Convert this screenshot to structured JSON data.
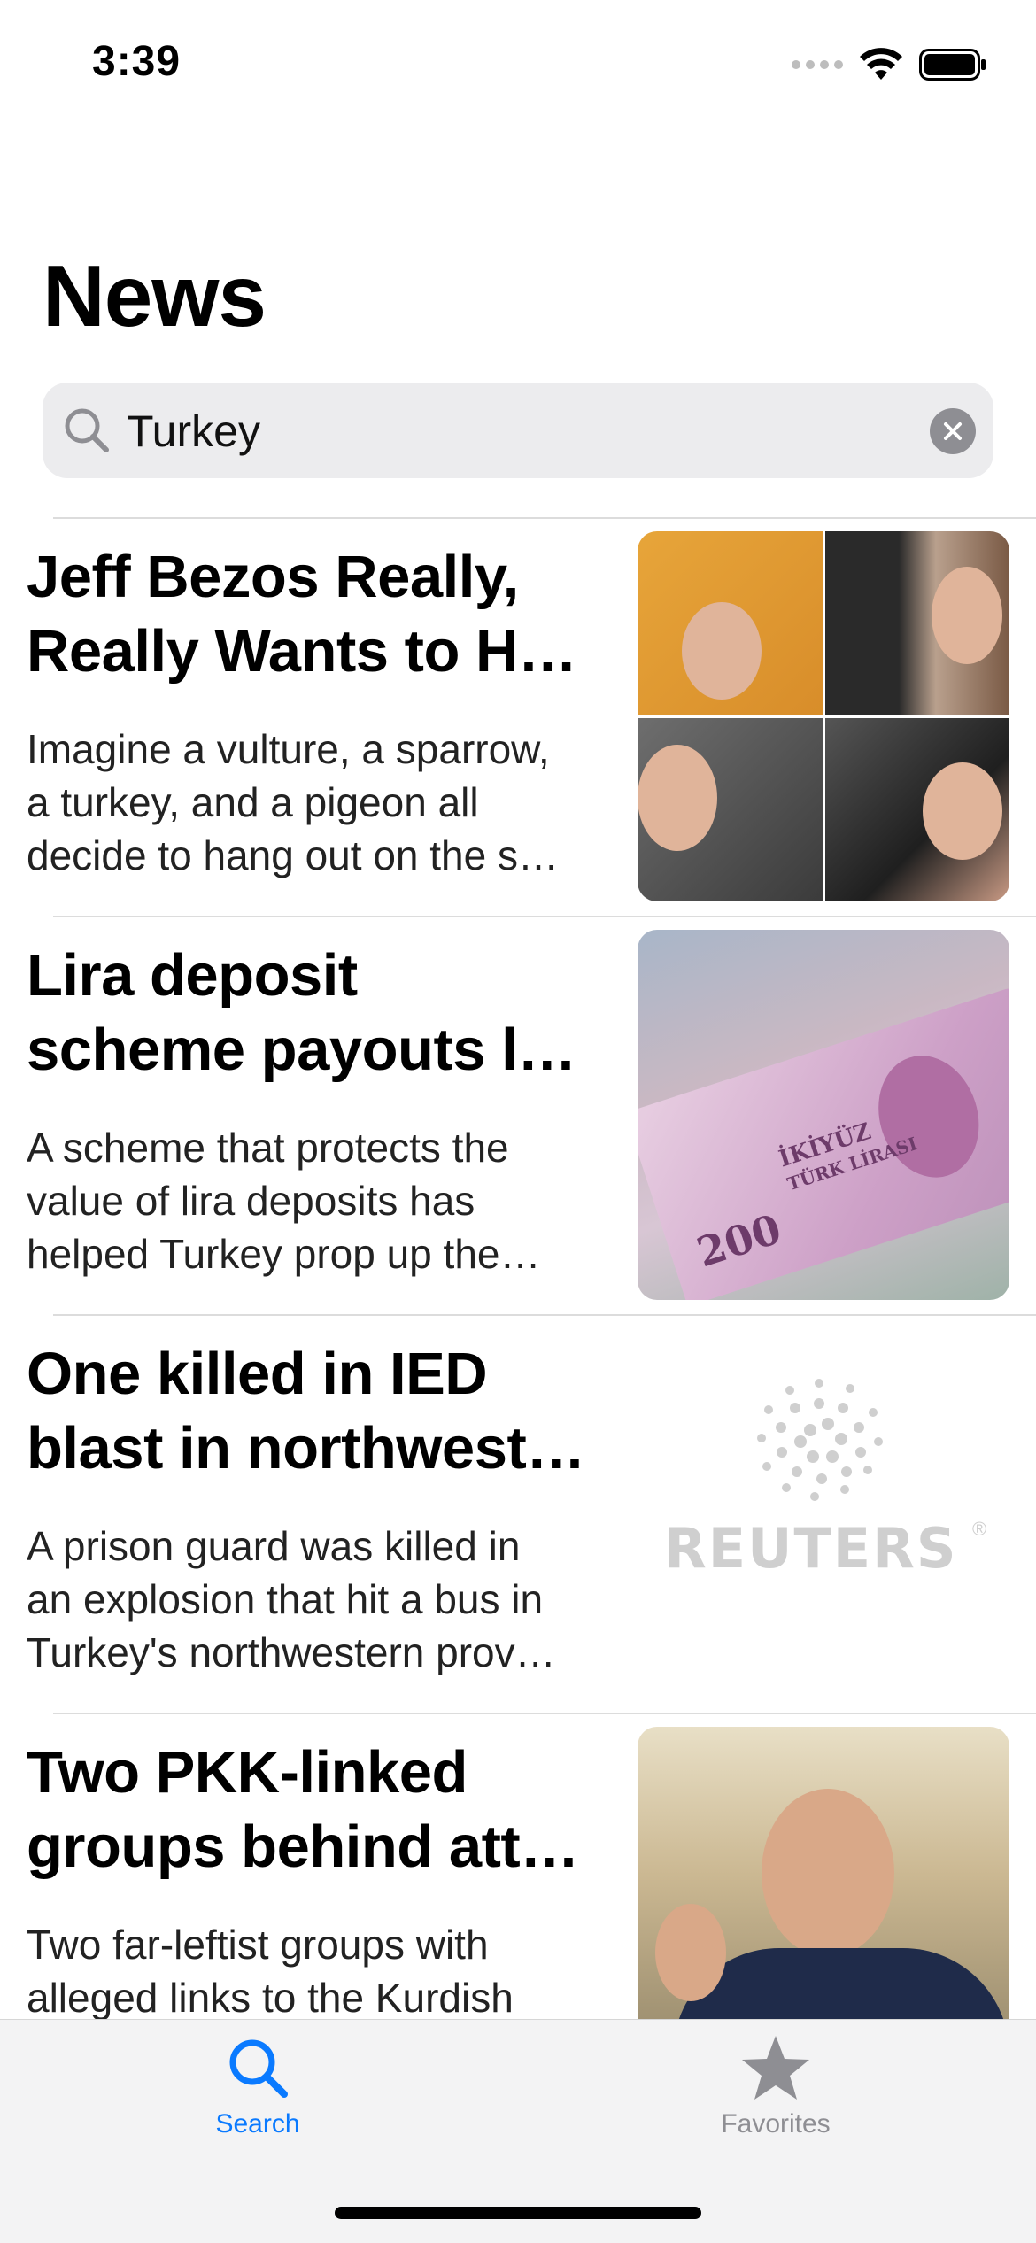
{
  "status_bar": {
    "time": "3:39"
  },
  "page": {
    "title": "News"
  },
  "search": {
    "query": "Turkey"
  },
  "articles": [
    {
      "title": "Jeff Bezos Really,\nReally Wants to H…",
      "summary": "Imagine a vulture, a sparrow,\na turkey, and a pigeon all\ndecide to hang out on the s…",
      "image": "celebrity-collage"
    },
    {
      "title": "Lira deposit\nscheme payouts l…",
      "summary": "A scheme that protects the\nvalue of lira deposits has\nhelped Turkey prop up the…",
      "image": "turkish-lira-banknote",
      "image_text": {
        "value": "200",
        "word": "İKİYÜZ",
        "currency": "TÜRK LİRASI"
      }
    },
    {
      "title": "One killed in IED\nblast in northwest…",
      "summary": "A prison guard was killed in\nan explosion that hit a bus in\nTurkey's northwestern prov…",
      "image": "reuters-logo",
      "image_text": {
        "logo": "REUTERS",
        "reg": "®"
      }
    },
    {
      "title": "Two PKK-linked\ngroups behind att…",
      "summary": "Two far-leftist groups with\nalleged links to the Kurdish",
      "image": "official-portrait"
    }
  ],
  "tabs": [
    {
      "label": "Search",
      "icon": "magnifier",
      "active": true,
      "color": "#0a7aff"
    },
    {
      "label": "Favorites",
      "icon": "star",
      "active": false,
      "color": "#8e8e93"
    }
  ]
}
